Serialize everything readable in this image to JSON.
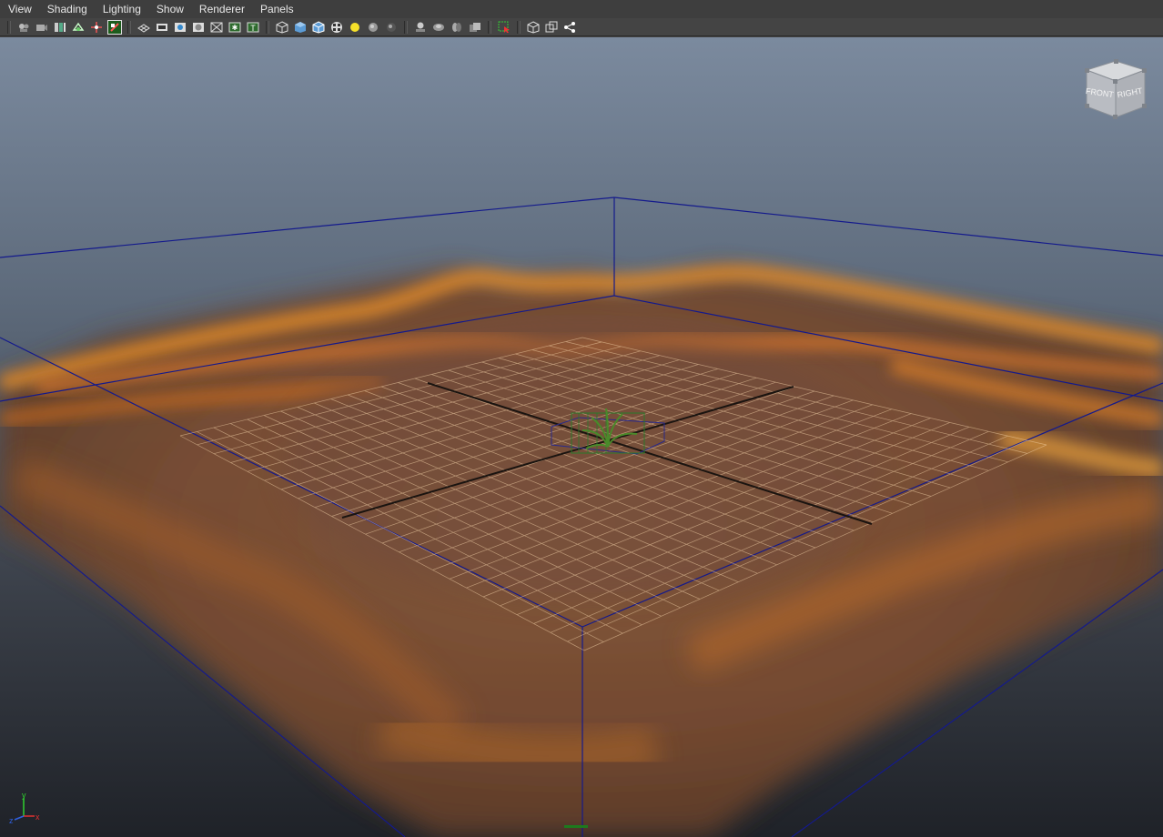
{
  "menus": [
    "View",
    "Shading",
    "Lighting",
    "Show",
    "Renderer",
    "Panels"
  ],
  "toolbar": {
    "group1": [
      "camera-select-icon",
      "camera-attributes-icon",
      "bookmarks-icon",
      "image-plane-icon",
      "2d-pan-zoom-icon",
      "grease-pencil-icon"
    ],
    "group2": [
      "grid-icon",
      "film-gate-icon",
      "resolution-gate-icon",
      "gate-mask-icon",
      "field-chart-icon",
      "safe-action-icon",
      "safe-title-icon"
    ],
    "group3": [
      "wireframe-icon",
      "smooth-shade-icon",
      "wireframe-on-shaded-icon",
      "textured-icon",
      "use-lights-icon",
      "shadows-icon",
      "screen-space-ao-icon"
    ],
    "group4": [
      "motion-blur-icon",
      "multisample-aa-icon",
      "depth-of-field-icon",
      "hardware-fog-icon"
    ],
    "group5": [
      "isolate-select-icon"
    ],
    "group6": [
      "xray-icon",
      "xray-active-components-icon",
      "xray-joints-icon"
    ]
  },
  "viewcube": {
    "front_label": "FRONT",
    "right_label": "RIGHT"
  },
  "axis": {
    "x_label": "x",
    "y_label": "y",
    "z_label": "z"
  },
  "colors": {
    "bg_top": "#7b8a9e",
    "bg_bottom": "#1f2228",
    "bounding_box": "#141a8c",
    "grid": "#f3d2a8",
    "terrain": "#c96a1a"
  }
}
